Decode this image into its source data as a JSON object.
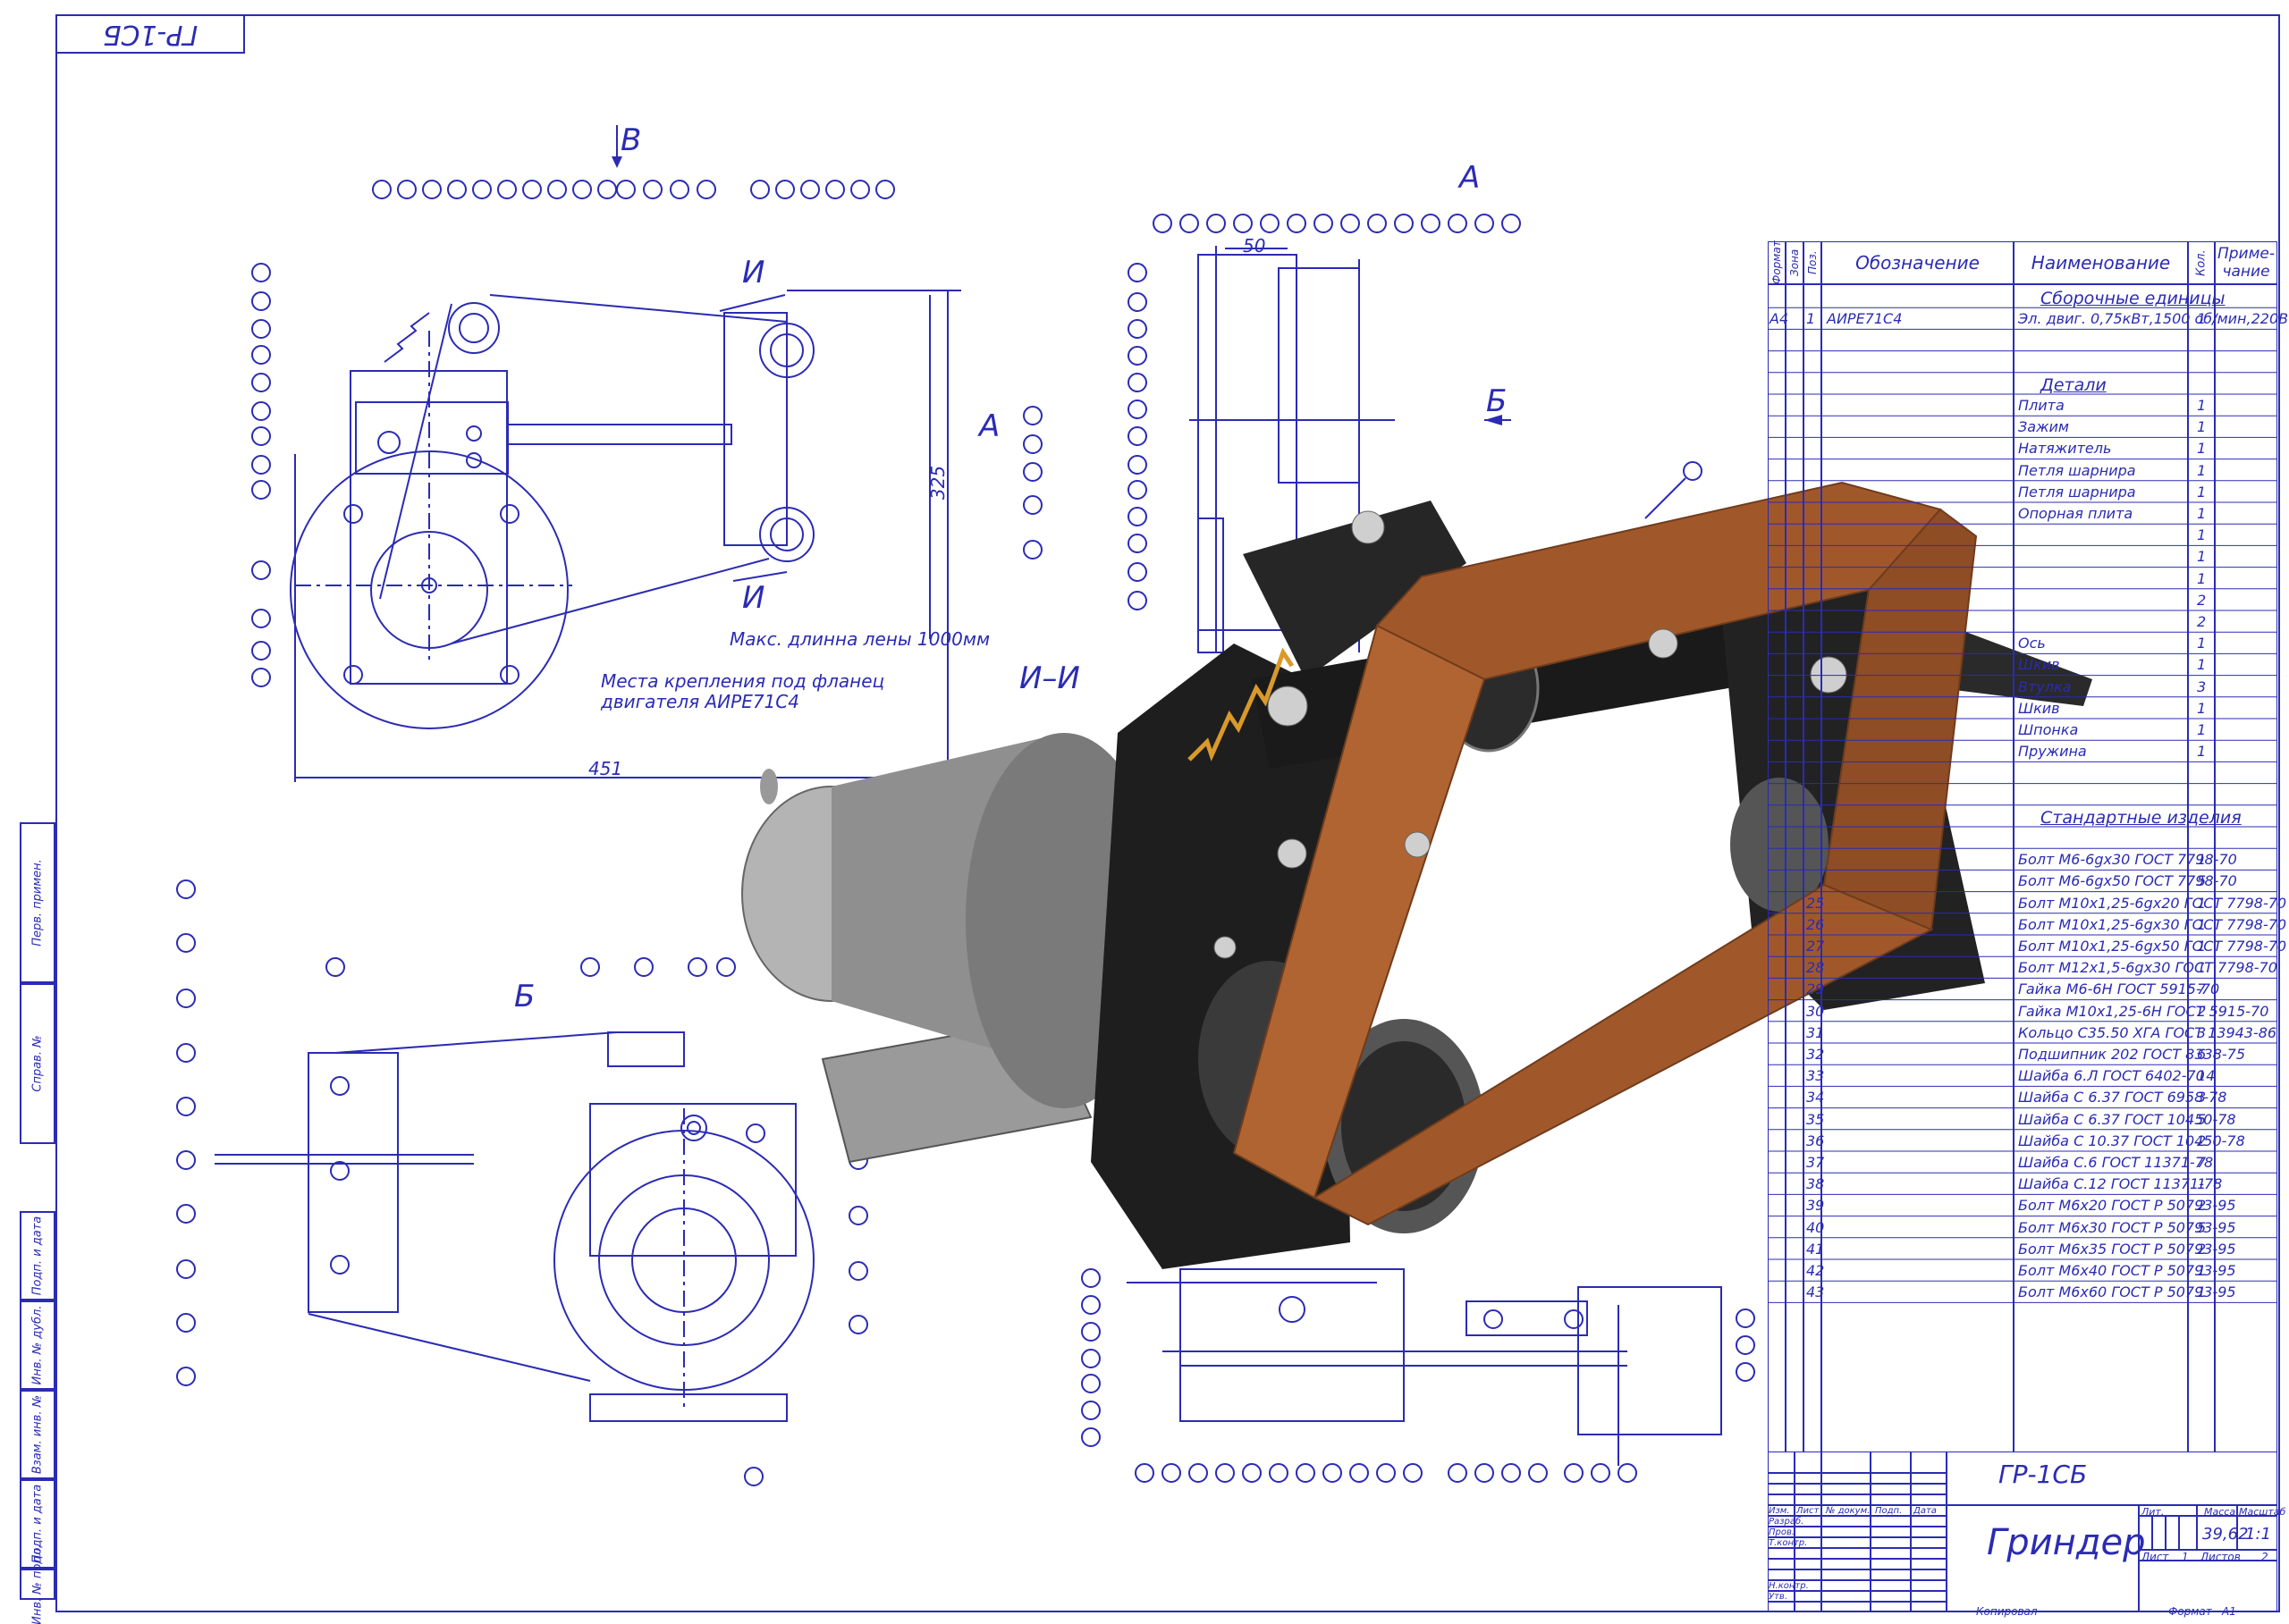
{
  "sheet": {
    "corner_code": "ГР-1СБ",
    "format_label": "Формат",
    "format_value": "А1",
    "copied_label": "Копировал"
  },
  "views": {
    "view_b_arrow": "В",
    "view_a_label": "А",
    "view_a_arrow": "А",
    "view_b_cyr": "Б",
    "view_b_cyr_arrow": "Б",
    "section_label": "И–И",
    "section_mark_top": "И",
    "section_mark_bottom": "И",
    "dim_50": "50",
    "dim_325": "325",
    "dim_451": "451",
    "note_belt": "Макс. длинна лены 1000мм",
    "note_flange_1": "Места крепления под фланец",
    "note_flange_2": "двигателя АИРЕ71С4"
  },
  "spec": {
    "headers": {
      "format": "Формат",
      "zone": "Зона",
      "pos": "Поз.",
      "designation": "Обозначение",
      "name": "Наименование",
      "qty": "Кол.",
      "note": "Приме- чание"
    },
    "rows": [
      {
        "kind": "section",
        "name": "Сборочные единицы"
      },
      {
        "fmt": "А4",
        "pos": "1",
        "des": "АИРЕ71С4",
        "name": "Эл. двиг. 0,75кВт,1500 об/мин,220В",
        "qty": "1"
      },
      {
        "kind": "blank"
      },
      {
        "kind": "blank"
      },
      {
        "kind": "section",
        "name": "Детали"
      },
      {
        "name": "Плита",
        "qty": "1"
      },
      {
        "name": "Зажим",
        "qty": "1"
      },
      {
        "name": "Натяжитель",
        "qty": "1"
      },
      {
        "name": "Петля шарнира",
        "qty": "1"
      },
      {
        "name": "Петля шарнира",
        "qty": "1"
      },
      {
        "name": "Опорная плита",
        "qty": "1"
      },
      {
        "name": "",
        "qty": "1"
      },
      {
        "name": "",
        "qty": "1"
      },
      {
        "name": "",
        "qty": "1"
      },
      {
        "name": "",
        "qty": "2"
      },
      {
        "name": "",
        "qty": "2"
      },
      {
        "name": "Ось",
        "qty": "1"
      },
      {
        "name": "Шкив",
        "qty": "1"
      },
      {
        "name": "Втулка",
        "qty": "3"
      },
      {
        "name": "Шкив",
        "qty": "1"
      },
      {
        "name": "Шпонка",
        "qty": "1"
      },
      {
        "name": "Пружина",
        "qty": "1"
      },
      {
        "kind": "blank"
      },
      {
        "kind": "blank"
      },
      {
        "kind": "section",
        "name": "Стандартные изделия"
      },
      {
        "kind": "blank"
      },
      {
        "pos": "",
        "name": "Болт М6-6gх30 ГОСТ 7798-70",
        "qty": "1"
      },
      {
        "pos": "",
        "name": "Болт М6-6gх50 ГОСТ 7798-70",
        "qty": "5"
      },
      {
        "pos": "25",
        "name": "Болт М10х1,25-6gх20 ГОСТ 7798-70",
        "qty": "1"
      },
      {
        "pos": "26",
        "name": "Болт М10х1,25-6gх30 ГОСТ 7798-70",
        "qty": "1"
      },
      {
        "pos": "27",
        "name": "Болт М10х1,25-6gх50 ГОСТ 7798-70",
        "qty": "1"
      },
      {
        "pos": "28",
        "name": "Болт М12х1,5-6gх30 ГОСТ 7798-70",
        "qty": "1"
      },
      {
        "pos": "29",
        "name": "Гайка М6-6Н ГОСТ 5915-70",
        "qty": "7"
      },
      {
        "pos": "30",
        "name": "Гайка М10х1,25-6Н ГОСТ 5915-70",
        "qty": "2"
      },
      {
        "pos": "31",
        "name": "Кольцо С35.50 ХГА ГОСТ 13943-86",
        "qty": "3"
      },
      {
        "pos": "32",
        "name": "Подшипник 202 ГОСТ 8338-75",
        "qty": "6"
      },
      {
        "pos": "33",
        "name": "Шайба 6.Л ГОСТ 6402-70",
        "qty": "14"
      },
      {
        "pos": "34",
        "name": "Шайба С 6.37 ГОСТ 6958-78",
        "qty": "3"
      },
      {
        "pos": "35",
        "name": "Шайба С 6.37 ГОСТ 10450-78",
        "qty": "5"
      },
      {
        "pos": "36",
        "name": "Шайба С 10.37 ГОСТ 10450-78",
        "qty": "2"
      },
      {
        "pos": "37",
        "name": "Шайба С.6 ГОСТ 11371-78",
        "qty": "7"
      },
      {
        "pos": "38",
        "name": "Шайба С.12 ГОСТ 11371-78",
        "qty": "1"
      },
      {
        "pos": "39",
        "name": "Болт М6х20 ГОСТ Р 50793-95",
        "qty": "2"
      },
      {
        "pos": "40",
        "name": "Болт М6х30 ГОСТ Р 50793-95",
        "qty": "5"
      },
      {
        "pos": "41",
        "name": "Болт М6х35 ГОСТ Р 50793-95",
        "qty": "2"
      },
      {
        "pos": "42",
        "name": "Болт М6х40 ГОСТ Р 50793-95",
        "qty": "1"
      },
      {
        "pos": "43",
        "name": "Болт М6х60 ГОСТ Р 50793-95",
        "qty": "1"
      }
    ]
  },
  "title_block": {
    "doc_code": "ГР-1СБ",
    "title": "Гриндер",
    "lit_label": "Лит.",
    "mass_label": "Масса",
    "scale_label": "Масштаб",
    "mass": "39,62",
    "scale": "1:1",
    "sheet_label": "Лист",
    "sheet_no": "1",
    "sheets_label": "Листов",
    "sheets": "2",
    "col_izm": "Изм.",
    "col_list": "Лист",
    "col_doc": "№ докум.",
    "col_sign": "Подп.",
    "col_date": "Дата",
    "razrab": "Разраб.",
    "prov": "Пров.",
    "tkontr": "Т.контр.",
    "nkontr": "Н.контр.",
    "utv": "Утв."
  },
  "side_stamp": [
    "Перв. примен.",
    "Справ. №",
    "Подп. и дата",
    "Инв. № дубл.",
    "Взам. инв. №",
    "Подп. и дата",
    "Инв. № подл."
  ],
  "colors": {
    "ink": "#2b2bb4",
    "belt": "#a0582a",
    "metal_dark": "#1e1e1e",
    "motor_grey": "#8c8c8c"
  }
}
